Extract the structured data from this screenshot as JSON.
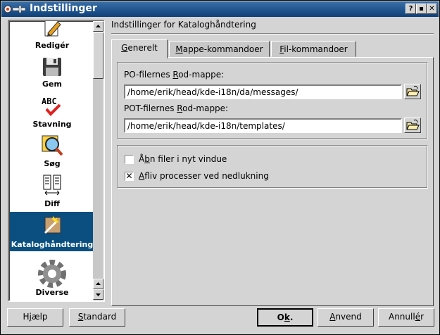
{
  "window": {
    "title": "Indstillinger",
    "controls": {
      "help": "?",
      "minimize": "▪",
      "close": "✕"
    }
  },
  "sidebar": {
    "items": [
      {
        "label": "Redigér",
        "icon": "edit-icon"
      },
      {
        "label": "Gem",
        "icon": "floppy-disk-icon"
      },
      {
        "label": "Stavning",
        "icon": "spellcheck-icon"
      },
      {
        "label": "Søg",
        "icon": "search-icon"
      },
      {
        "label": "Diff",
        "icon": "diff-icon"
      },
      {
        "label": "Kataloghåndtering",
        "icon": "catalog-manager-icon",
        "selected": true
      },
      {
        "label": "Diverse",
        "icon": "gear-icon"
      }
    ]
  },
  "main": {
    "title": "Indstillinger for Kataloghåndtering",
    "tabs": [
      {
        "pre": "",
        "key": "G",
        "post": "enerelt",
        "active": true
      },
      {
        "pre": "",
        "key": "M",
        "post": "appe-kommandoer",
        "active": false
      },
      {
        "pre": "",
        "key": "F",
        "post": "il-kommandoer",
        "active": false
      }
    ],
    "po_label": {
      "pre": "PO-filernes ",
      "key": "R",
      "post": "od-mappe:"
    },
    "po_value": "/home/erik/head/kde-i18n/da/messages/",
    "pot_label": {
      "pre": "POT-filernes ",
      "key": "R",
      "post": "od-mappe:"
    },
    "pot_value": "/home/erik/head/kde-i18n/templates/",
    "options": [
      {
        "pre": "Å",
        "key": "b",
        "post": "n filer i nyt vindue",
        "checked": false,
        "mark": ""
      },
      {
        "pre": "",
        "key": "A",
        "post": "fliv processer ved nedlukning",
        "checked": true,
        "mark": "✕"
      }
    ]
  },
  "buttons": {
    "help": {
      "pre": "H",
      "key": "j",
      "post": "ælp"
    },
    "standard": {
      "pre": "",
      "key": "S",
      "post": "tandard"
    },
    "ok": {
      "pre": "O",
      "key": "k",
      "post": "."
    },
    "apply": {
      "pre": "",
      "key": "A",
      "post": "nvend"
    },
    "cancel": {
      "pre": "Annull",
      "key": "é",
      "post": "r"
    }
  },
  "colors": {
    "selection": "#0a4f80",
    "titlebar": "#0e3f78",
    "face": "#d4d4d4"
  }
}
